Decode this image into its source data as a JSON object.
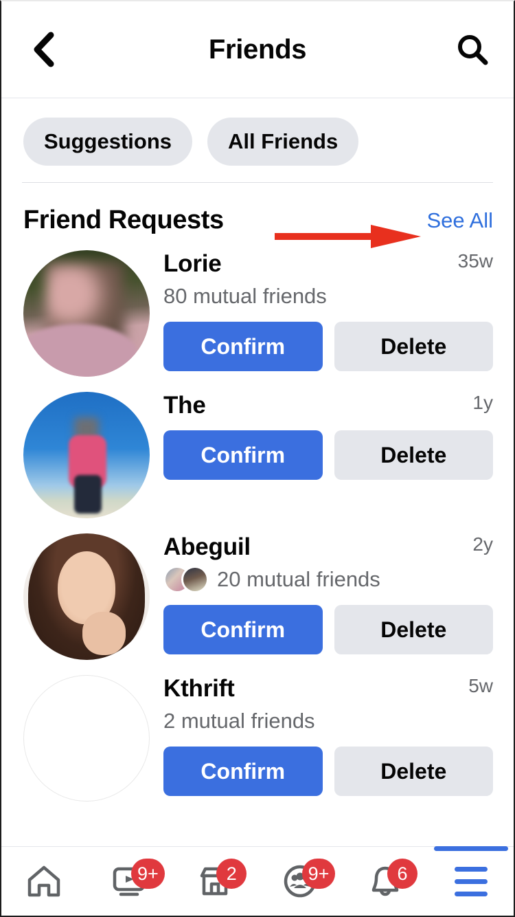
{
  "header": {
    "title": "Friends",
    "back_icon": "chevron-left-icon",
    "search_icon": "search-icon"
  },
  "filters": [
    {
      "label": "Suggestions"
    },
    {
      "label": "All Friends"
    }
  ],
  "section": {
    "title": "Friend Requests",
    "see_all": "See All",
    "annotation_arrow_color": "#e8301e"
  },
  "requests": [
    {
      "name": "Lorie",
      "time": "35w",
      "mutual": "80 mutual friends",
      "has_mutual_faces": false,
      "avatar": "blurred-photo-foliage",
      "confirm_label": "Confirm",
      "delete_label": "Delete"
    },
    {
      "name": "The",
      "time": "1y",
      "mutual": "",
      "has_mutual_faces": false,
      "avatar": "blurred-photo-beach",
      "confirm_label": "Confirm",
      "delete_label": "Delete"
    },
    {
      "name": "Abeguil",
      "time": "2y",
      "mutual": "20 mutual friends",
      "has_mutual_faces": true,
      "avatar": "portrait-photo",
      "confirm_label": "Confirm",
      "delete_label": "Delete"
    },
    {
      "name": "Kthrift",
      "time": "5w",
      "mutual": "2 mutual friends",
      "has_mutual_faces": false,
      "avatar": "empty-placeholder",
      "confirm_label": "Confirm",
      "delete_label": "Delete"
    }
  ],
  "bottom_nav": {
    "items": [
      {
        "icon": "home-icon",
        "badge": "",
        "active": false
      },
      {
        "icon": "video-icon",
        "badge": "9+",
        "active": false
      },
      {
        "icon": "marketplace-icon",
        "badge": "2",
        "active": false
      },
      {
        "icon": "groups-icon",
        "badge": "9+",
        "active": false
      },
      {
        "icon": "bell-icon",
        "badge": "6",
        "active": false
      },
      {
        "icon": "menu-icon",
        "badge": "",
        "active": true
      }
    ]
  },
  "colors": {
    "accent_blue": "#3b6fdf",
    "link_blue": "#2f6fdd",
    "chip_gray": "#e4e6eb",
    "badge_red": "#e0393e",
    "arrow_red": "#e8301e",
    "secondary_text": "#65676b"
  }
}
